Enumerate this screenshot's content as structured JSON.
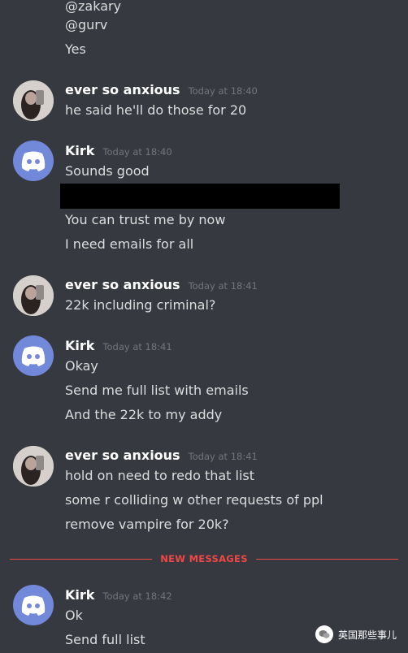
{
  "top_lines": [
    "@zakary",
    "@gurv",
    "Yes"
  ],
  "messages": [
    {
      "author": "ever so anxious",
      "timestamp": "Today at 18:40",
      "lines": [
        "he said he'll do those for 20"
      ]
    },
    {
      "author": "Kirk",
      "timestamp": "Today at 18:40",
      "lines": [
        "Sounds good",
        "You can trust me by now",
        "I need emails for all"
      ]
    },
    {
      "author": "ever so anxious",
      "timestamp": "Today at 18:41",
      "lines": [
        "22k including criminal?"
      ]
    },
    {
      "author": "Kirk",
      "timestamp": "Today at 18:41",
      "lines": [
        "Okay",
        "Send me full list with emails",
        "And the 22k to my addy"
      ]
    },
    {
      "author": "ever so anxious",
      "timestamp": "Today at 18:41",
      "lines": [
        "hold on need to redo that list",
        "some r colliding w other requests of ppl",
        "remove vampire for 20k?"
      ]
    },
    {
      "author": "Kirk",
      "timestamp": "Today at 18:42",
      "lines": [
        "Ok",
        "Send full list"
      ]
    }
  ],
  "divider_label": "NEW MESSAGES",
  "watermark": "英国那些事儿",
  "colors": {
    "background": "#36393f",
    "text": "#dcddde",
    "username": "#ffffff",
    "timestamp": "#72767d",
    "new_messages": "#f04747",
    "bot_avatar": "#7289da"
  },
  "icons": {
    "user_avatar": "profile-photo",
    "bot_avatar": "discord-logo-icon"
  }
}
